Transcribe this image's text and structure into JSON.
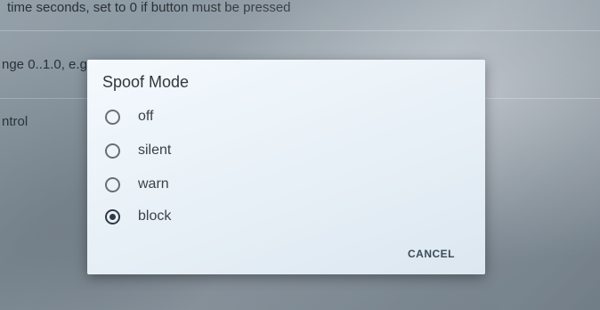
{
  "background": {
    "line1": "time seconds, set to 0 if button must be pressed",
    "line2": "nge 0..1.0, e.g",
    "line3": "ntrol"
  },
  "dialog": {
    "title": "Spoof Mode",
    "options": [
      {
        "label": "off",
        "selected": false
      },
      {
        "label": "silent",
        "selected": false
      },
      {
        "label": "warn",
        "selected": false
      },
      {
        "label": "block",
        "selected": true
      }
    ],
    "cancel_label": "CANCEL"
  }
}
